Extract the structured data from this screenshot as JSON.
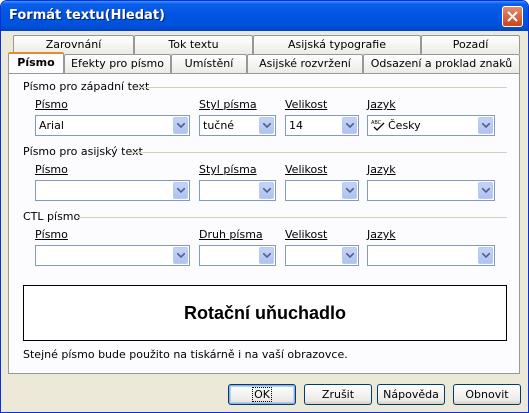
{
  "window": {
    "title": "Formát textu(Hledat)"
  },
  "tabs_back": [
    {
      "label": "Zarovnání"
    },
    {
      "label": "Tok textu"
    },
    {
      "label": "Asijská typografie"
    },
    {
      "label": "Pozadí"
    }
  ],
  "tabs_front": [
    {
      "label": "Písmo",
      "active": true
    },
    {
      "label": "Efekty pro písmo"
    },
    {
      "label": "Umístění"
    },
    {
      "label": "Asijské rozvržení"
    },
    {
      "label": "Odsazení a proklad znaků"
    }
  ],
  "western": {
    "heading": "Písmo pro západní text",
    "font_label": "Písmo",
    "style_label": "Styl písma",
    "size_label": "Velikost",
    "lang_label": "Jazyk",
    "font_value": "Arial",
    "style_value": "tučné",
    "size_value": "14",
    "lang_value": "Česky"
  },
  "asian": {
    "heading": "Písmo pro asijský text",
    "font_label": "Písmo",
    "style_label": "Styl písma",
    "size_label": "Velikost",
    "lang_label": "Jazyk"
  },
  "ctl": {
    "heading": "CTL písmo",
    "font_label": "Písmo",
    "style_label": "Druh písma",
    "size_label": "Velikost",
    "lang_label": "Jazyk"
  },
  "preview_text": "Rotační uňuchadlo",
  "note": "Stejné písmo bude použito na tiskárně i na vaší obrazovce.",
  "buttons": {
    "ok": "OK",
    "cancel": "Zrušit",
    "help": "Nápověda",
    "reset": "Obnovit"
  }
}
